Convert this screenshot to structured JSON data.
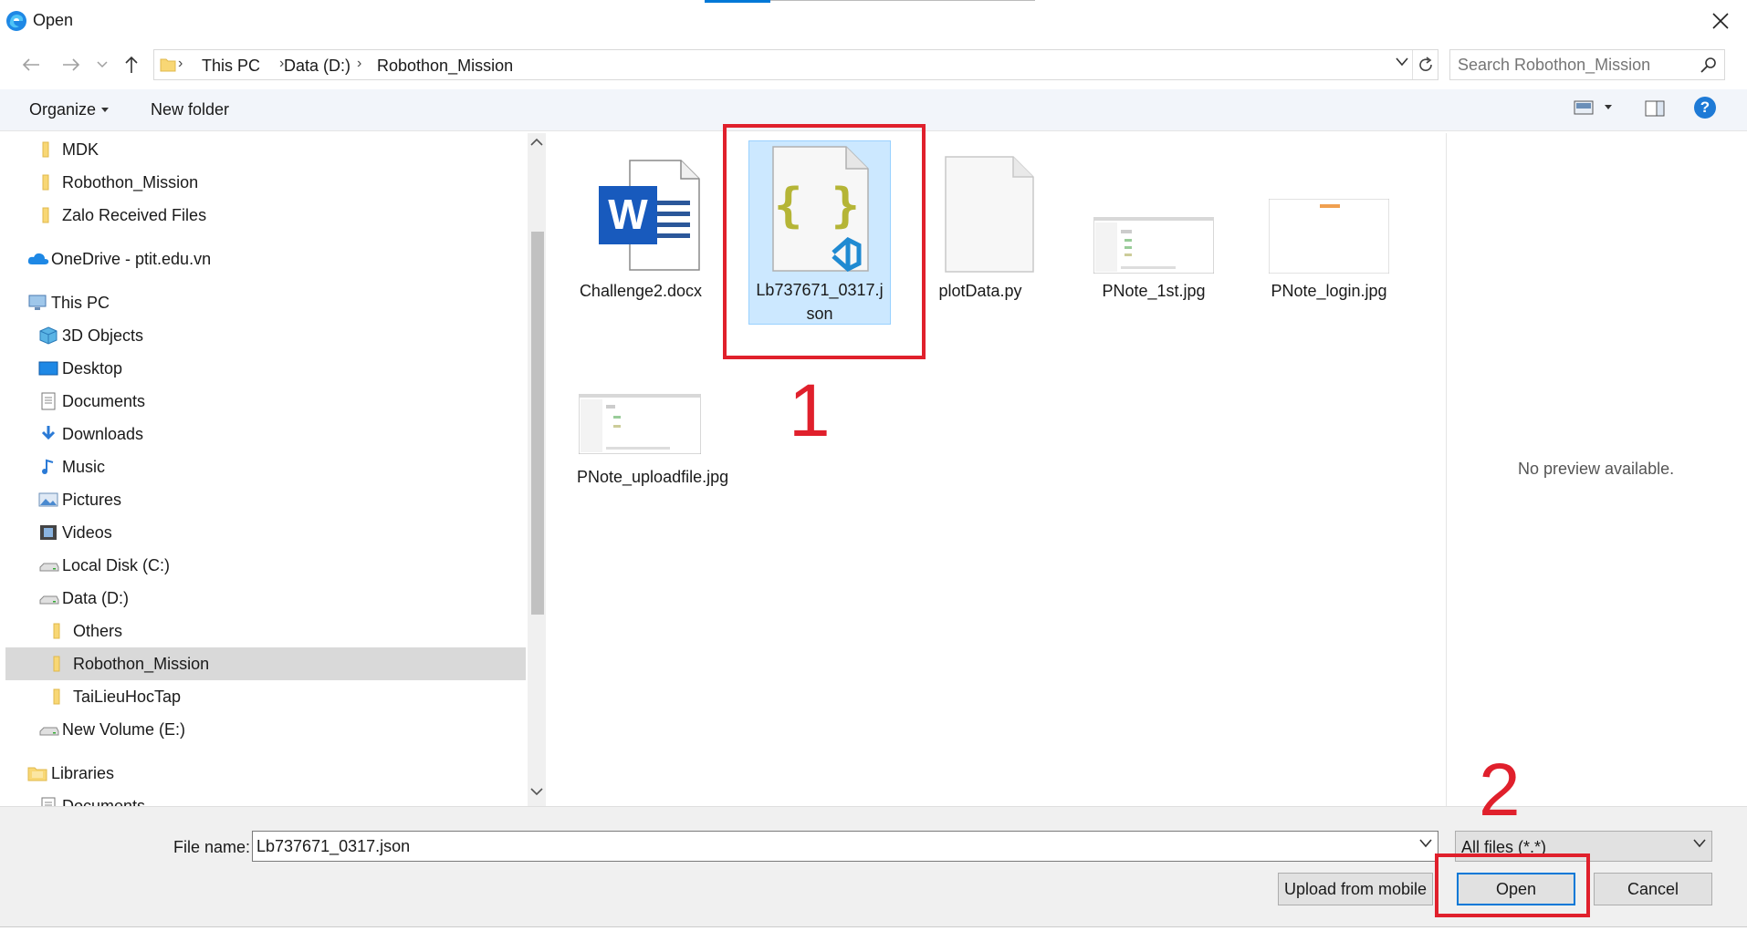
{
  "window": {
    "title": "Open"
  },
  "address": {
    "crumbs": [
      "This PC",
      "Data (D:)",
      "Robothon_Mission"
    ]
  },
  "search": {
    "placeholder": "Search Robothon_Mission"
  },
  "toolbar": {
    "organize_label": "Organize",
    "new_folder_label": "New folder"
  },
  "sidebar": {
    "items": [
      {
        "label": "MDK",
        "icon": "folder-icon"
      },
      {
        "label": "Robothon_Mission",
        "icon": "folder-icon"
      },
      {
        "label": "Zalo Received Files",
        "icon": "folder-icon"
      },
      {
        "label": "OneDrive - ptit.edu.vn",
        "icon": "cloud-icon"
      },
      {
        "label": "This PC",
        "icon": "computer-icon"
      },
      {
        "label": "3D Objects",
        "icon": "cube-icon"
      },
      {
        "label": "Desktop",
        "icon": "desktop-icon"
      },
      {
        "label": "Documents",
        "icon": "documents-icon"
      },
      {
        "label": "Downloads",
        "icon": "download-icon"
      },
      {
        "label": "Music",
        "icon": "music-icon"
      },
      {
        "label": "Pictures",
        "icon": "pictures-icon"
      },
      {
        "label": "Videos",
        "icon": "videos-icon"
      },
      {
        "label": "Local Disk (C:)",
        "icon": "drive-icon"
      },
      {
        "label": "Data (D:)",
        "icon": "drive-icon"
      },
      {
        "label": "Others",
        "icon": "folder-icon"
      },
      {
        "label": "Robothon_Mission",
        "icon": "folder-icon",
        "selected": true
      },
      {
        "label": "TaiLieuHocTap",
        "icon": "folder-icon"
      },
      {
        "label": "New Volume (E:)",
        "icon": "drive-icon"
      },
      {
        "label": "Libraries",
        "icon": "libraries-icon"
      },
      {
        "label": "Documents",
        "icon": "documents-icon"
      }
    ]
  },
  "files": [
    {
      "name": "Challenge2.docx",
      "type": "word-doc-icon"
    },
    {
      "name": "Lb737671_0317.json",
      "type": "json-file-icon",
      "selected": true
    },
    {
      "name": "plotData.py",
      "type": "blank-file-icon"
    },
    {
      "name": "PNote_1st.jpg",
      "type": "image-thumbnail"
    },
    {
      "name": "PNote_login.jpg",
      "type": "image-thumbnail"
    },
    {
      "name": "PNote_uploadfile.jpg",
      "type": "image-thumbnail"
    }
  ],
  "preview": {
    "text": "No preview available."
  },
  "footer": {
    "file_name_label": "File name:",
    "file_name_value": "Lb737671_0317.json",
    "file_type_label": "All files (*.*)",
    "upload_label": "Upload from mobile",
    "open_label": "Open",
    "cancel_label": "Cancel"
  },
  "annotations": {
    "step1": "1",
    "step2": "2"
  },
  "colors": {
    "accent": "#0078d7",
    "annotation": "#e0202c",
    "selection": "#cce8ff",
    "folder": "#f8d775"
  }
}
